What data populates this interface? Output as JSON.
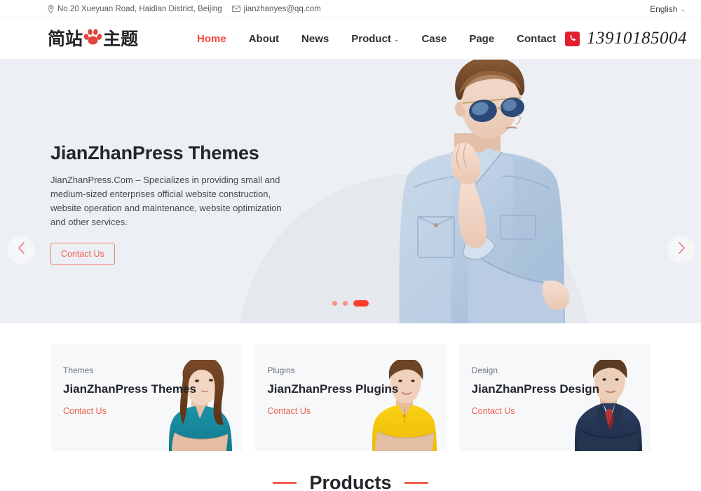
{
  "topbar": {
    "address": "No.20 Xueyuan Road, Haidian District, Beijing",
    "email": "jianzhanyes@qq.com",
    "address_icon": "map-pin-icon",
    "email_icon": "mail-icon",
    "language": "English",
    "language_caret": "⌄"
  },
  "header": {
    "logo_left": "简站",
    "logo_icon": "paw-icon",
    "logo_right": "主题",
    "nav": [
      {
        "label": "Home",
        "active": true,
        "caret": ""
      },
      {
        "label": "About",
        "active": false,
        "caret": ""
      },
      {
        "label": "News",
        "active": false,
        "caret": ""
      },
      {
        "label": "Product",
        "active": false,
        "caret": "⌄"
      },
      {
        "label": "Case",
        "active": false,
        "caret": ""
      },
      {
        "label": "Page",
        "active": false,
        "caret": ""
      },
      {
        "label": "Contact",
        "active": false,
        "caret": ""
      }
    ],
    "phone_icon": "phone-icon",
    "phone": "13910185004"
  },
  "hero": {
    "title": "JianZhanPress Themes",
    "description": "JianZhanPress.Com – Specializes in providing small and medium-sized enterprises official website construction, website operation and maintenance, website optimization and other services.",
    "button_label": "Contact Us",
    "prev_icon": "chevron-left-icon",
    "next_icon": "chevron-right-icon",
    "slides": 3,
    "active_slide": 3,
    "photo_alt": "man-in-denim-jacket-with-sunglasses"
  },
  "cards": [
    {
      "kicker": "Themes",
      "title": "JianZhanPress Themes",
      "link": "Contact Us",
      "photo_alt": "woman-in-teal-top"
    },
    {
      "kicker": "Plugins",
      "title": "JianZhanPress Plugins",
      "link": "Contact Us",
      "photo_alt": "man-in-yellow-polo"
    },
    {
      "kicker": "Design",
      "title": "JianZhanPress Design",
      "link": "Contact Us",
      "photo_alt": "man-in-navy-suit"
    }
  ],
  "products": {
    "title": "Products"
  },
  "colors": {
    "accent_red": "#f2604f",
    "brand_red": "#f5453a",
    "phone_red": "#e0202d",
    "hero_bg": "#eceff3",
    "card_bg": "#f7f8fa"
  }
}
